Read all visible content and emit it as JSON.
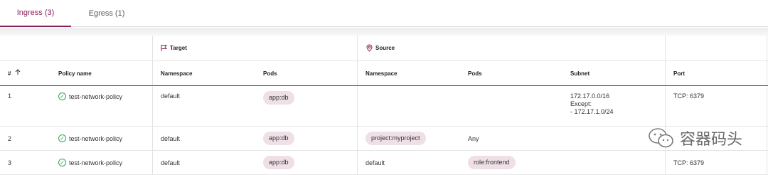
{
  "tabs": [
    {
      "label": "Ingress (3)",
      "active": true
    },
    {
      "label": "Egress (1)",
      "active": false
    }
  ],
  "groups": {
    "target": "Target",
    "source": "Source"
  },
  "columns": {
    "index": "#",
    "sort_icon": "arrow-up-icon",
    "policy_name": "Policy name",
    "target_namespace": "Namespace",
    "target_pods": "Pods",
    "source_namespace": "Namespace",
    "source_pods": "Pods",
    "subnet": "Subnet",
    "port": "Port"
  },
  "rows": [
    {
      "index": "1",
      "policy": "test-network-policy",
      "target_namespace": "default",
      "target_pods": "app:db",
      "source_namespace": "",
      "source_pods": "",
      "subnet_line1": "172.17.0.0/16",
      "subnet_line2": "Except:",
      "subnet_line3": "- 172.17.1.0/24",
      "port": "TCP: 6379"
    },
    {
      "index": "2",
      "policy": "test-network-policy",
      "target_namespace": "default",
      "target_pods": "app:db",
      "source_namespace": "project:myproject",
      "source_pods": "Any",
      "subnet": "",
      "port": ""
    },
    {
      "index": "3",
      "policy": "test-network-policy",
      "target_namespace": "default",
      "target_pods": "app:db",
      "source_namespace": "default",
      "source_pods": "role:frontend",
      "subnet": "",
      "port": "TCP: 6379"
    }
  ],
  "watermark": {
    "text": "容器码头"
  },
  "colors": {
    "accent": "#8a1f5a",
    "pill_bg": "#efdfe6",
    "status_ok": "#2fa84f"
  }
}
